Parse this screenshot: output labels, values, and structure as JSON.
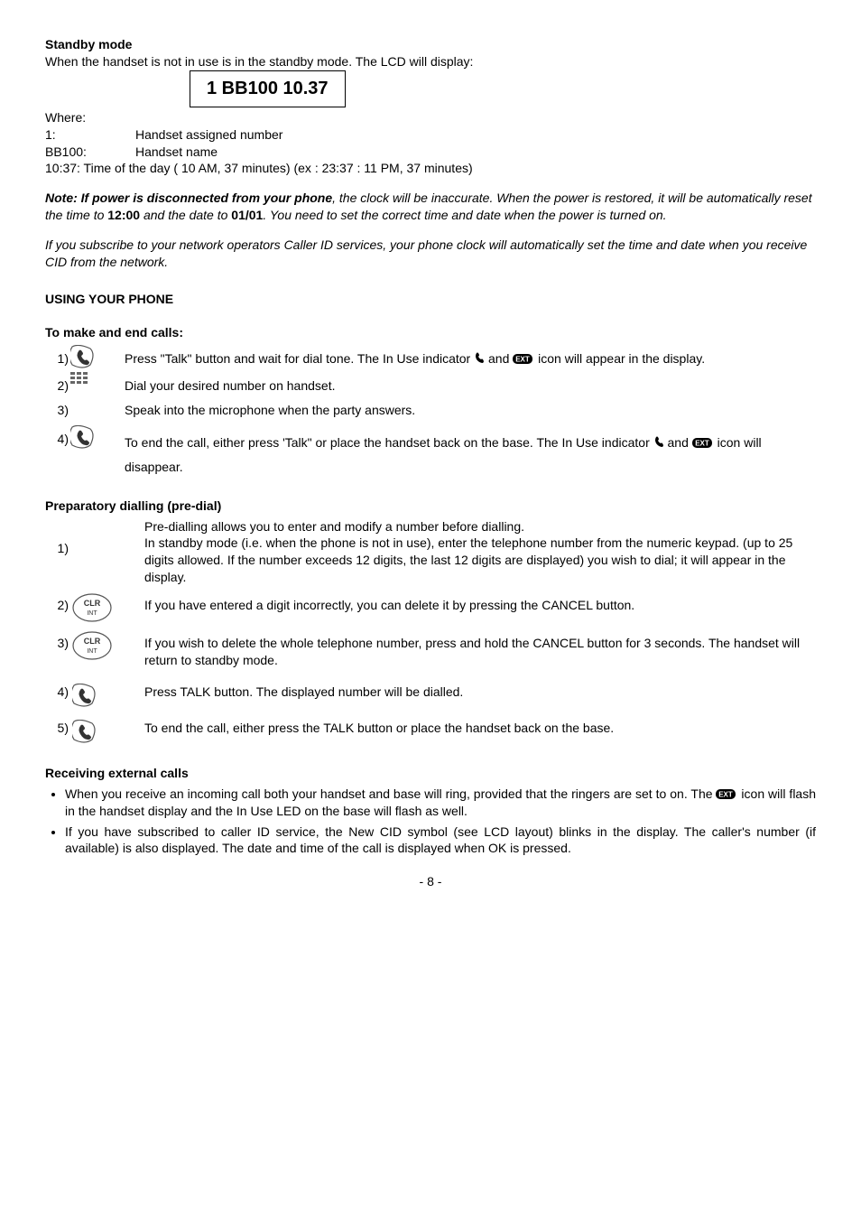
{
  "standby": {
    "heading": "Standby mode",
    "intro": "When the handset is not in use is in the standby mode. The LCD will display:",
    "box": "1 BB100 10.37",
    "where": "Where:",
    "defs": [
      {
        "label": "1:",
        "text": "Handset assigned number"
      },
      {
        "label": "BB100:",
        "text": "Handset name"
      }
    ],
    "time_line": "10:37:  Time of the day ( 10 AM, 37 minutes)   (ex : 23:37 : 11 PM, 37 minutes)"
  },
  "note": {
    "lead_bold_ital": "Note: If power is disconnected from your phone",
    "p1_ital_a": ", the clock will be inaccurate.    When the power is restored, it will be automatically reset the time to ",
    "p1_bold1": "12:00",
    "p1_ital_b": " and the date to ",
    "p1_bold2": "01/01",
    "p1_ital_c": ". You need to set the correct time and date when the power is turned on."
  },
  "subscribe": "If you subscribe to your network operators Caller ID services, your phone clock will automatically set the time and date when you receive CID from the network.",
  "using_heading": "USING YOUR PHONE",
  "make_end": {
    "heading": "To make and end calls:",
    "rows": [
      {
        "n": "1)",
        "icon": "talk-key-icon",
        "text_a": "Press \"Talk\" button and wait for dial tone.  The In Use indicator ",
        "text_b": " and ",
        "text_c": " icon will appear in the display."
      },
      {
        "n": "2)",
        "icon": "keypad-icon",
        "text": "Dial your desired number on handset."
      },
      {
        "n": "3)",
        "icon": "",
        "text": "Speak into the microphone when the party answers."
      },
      {
        "n": "4)",
        "icon": "talk-key-icon",
        "text_a": "To end the call, either press 'Talk\" or place the handset back on the base.  The In Use indicator  ",
        "text_b": " and ",
        "text_c": " icon will disappear."
      }
    ]
  },
  "prep": {
    "heading": "Preparatory dialling (pre-dial)",
    "pre_line": " Pre-dialling allows you to enter and modify a number before dialling.",
    "rows": [
      {
        "n": "1)",
        "icon": "",
        "text": "In standby mode (i.e. when the phone is not in use), enter the telephone number from the numeric keypad. (up to 25 digits allowed.  If the number exceeds 12 digits, the last 12 digits are displayed) you wish to dial; it will appear in the display."
      },
      {
        "n": "2)",
        "icon": "clr-int-key-icon",
        "text": "If you have entered a digit incorrectly, you can delete it by pressing the CANCEL button."
      },
      {
        "n": "3)",
        "icon": "clr-int-key-icon",
        "text": "If you wish to delete the whole telephone number, press and hold the CANCEL button for 3 seconds.   The handset will return to standby mode."
      },
      {
        "n": "4)",
        "icon": "talk-key-icon",
        "text": "Press TALK button.   The displayed number will be dialled."
      },
      {
        "n": "5)",
        "icon": "talk-key-icon",
        "text": "To end the call, either press the TALK button or place the handset back on the base."
      }
    ]
  },
  "receiving": {
    "heading": "Receiving external calls",
    "b1_a": "When you receive an incoming call both your handset and base will ring, provided that the ringers are set to on.  The  ",
    "b1_b": " icon will flash in the handset display and the In Use LED on the base will flash as well.",
    "b2": "If you have subscribed to caller ID service, the New CID symbol (see LCD layout) blinks in the display.  The caller's number (if available) is also displayed.  The date and time of the call is displayed when OK is pressed."
  },
  "pagenum": "- 8 -"
}
